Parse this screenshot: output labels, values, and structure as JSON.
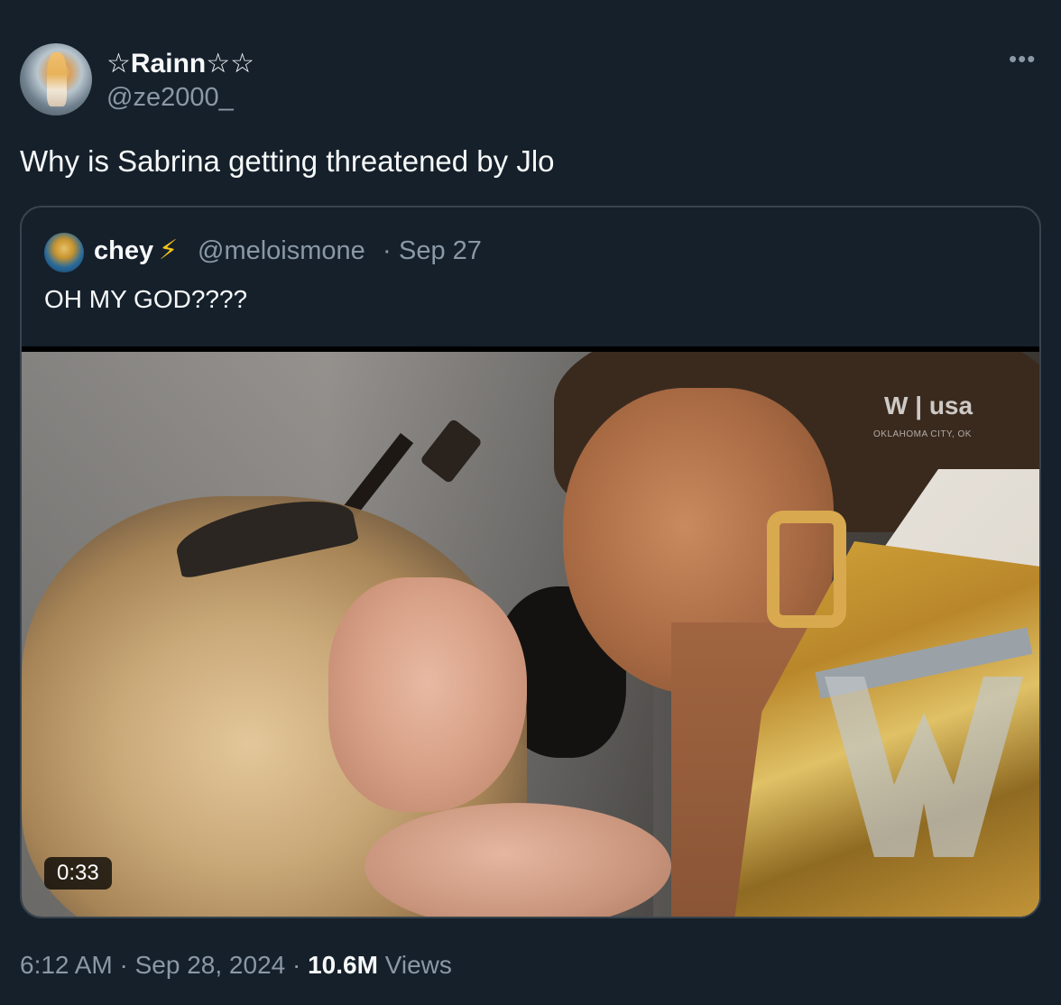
{
  "author": {
    "display_name": "☆Rainn☆☆",
    "handle": "@ze2000_",
    "avatar_icon": "profile-avatar"
  },
  "more_label": "•••",
  "tweet_text": "Why is Sabrina getting threatened by Jlo",
  "quoted": {
    "display_name": "chey",
    "emoji": "⚡",
    "handle": "@meloismone",
    "separator": "·",
    "date": "Sep 27",
    "text": "OH MY GOD????",
    "video": {
      "duration": "0:33",
      "watermark": "W | usa",
      "watermark_sub": "OKLAHOMA CITY, OK"
    }
  },
  "meta": {
    "time": "6:12 AM",
    "separator": "·",
    "date": "Sep 28, 2024",
    "views_count": "10.6M",
    "views_label": "Views"
  },
  "colors": {
    "background": "#15202b",
    "primary_text": "#f7f9f9",
    "secondary_text": "#8b98a5",
    "border": "#38444d",
    "bolt": "#f5c518"
  }
}
